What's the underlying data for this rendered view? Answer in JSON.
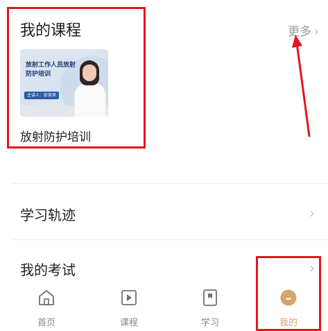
{
  "courses": {
    "title": "我的课程",
    "more_label": "更多",
    "more_chevron": "›",
    "items": [
      {
        "name": "放射防护培训",
        "thumb_title": "放射工作人员放射防护培训",
        "thumb_tag": "主讲人：彭俊男"
      }
    ]
  },
  "menu": {
    "track_label": "学习轨迹",
    "exam_label": "我的考试",
    "chevron": "›"
  },
  "tabbar": {
    "tabs": [
      {
        "label": "首页",
        "icon": "home-icon"
      },
      {
        "label": "课程",
        "icon": "play-icon"
      },
      {
        "label": "学习",
        "icon": "bookmark-icon"
      },
      {
        "label": "我的",
        "icon": "profile-icon",
        "active": true
      }
    ]
  },
  "colors": {
    "annotation_red": "#e3161c",
    "active_tab": "#d8a46a",
    "muted": "#8a8a8a"
  }
}
